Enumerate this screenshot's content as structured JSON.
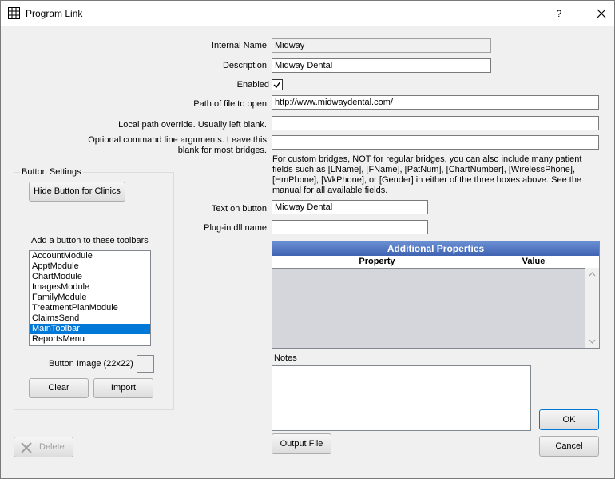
{
  "window": {
    "title": "Program Link",
    "help": "?",
    "close": "✕"
  },
  "labels": {
    "internal_name": "Internal Name",
    "description": "Description",
    "enabled": "Enabled",
    "path": "Path of file to open",
    "local_path": "Local path override.  Usually left blank.",
    "cmd_args": "Optional command line arguments.  Leave this blank for most bridges.",
    "text_on_button": "Text on button",
    "plugin_dll": "Plug-in dll name"
  },
  "fields": {
    "internal_name": "Midway",
    "description": "Midway Dental",
    "enabled": true,
    "path": "http://www.midwaydental.com/",
    "local_path": "",
    "cmd_args": "",
    "text_on_button": "Midway Dental",
    "plugin_dll": ""
  },
  "bridge_note": "For custom bridges, NOT for regular bridges, you can also include many patient fields such as [LName], [FName], [PatNum], [ChartNumber], [WirelessPhone], [HmPhone], [WkPhone], or [Gender] in either of the three boxes above. See the manual for all available fields.",
  "button_settings": {
    "group_title": "Button Settings",
    "hide_button": "Hide Button for Clinics",
    "toolbars_label": "Add a button to these toolbars",
    "toolbars": [
      "AccountModule",
      "ApptModule",
      "ChartModule",
      "ImagesModule",
      "FamilyModule",
      "TreatmentPlanModule",
      "ClaimsSend",
      "MainToolbar",
      "ReportsMenu"
    ],
    "selected_toolbar": "MainToolbar",
    "button_image_label": "Button Image (22x22)",
    "clear": "Clear",
    "import": "Import"
  },
  "additional_properties": {
    "title": "Additional Properties",
    "col_property": "Property",
    "col_value": "Value"
  },
  "notes": {
    "label": "Notes",
    "value": ""
  },
  "buttons": {
    "delete": "Delete",
    "output_file": "Output File",
    "ok": "OK",
    "cancel": "Cancel"
  },
  "colors": {
    "selection": "#0078d7",
    "grid_header": "#4a6fbf",
    "grid_body": "#d4d6dc"
  }
}
